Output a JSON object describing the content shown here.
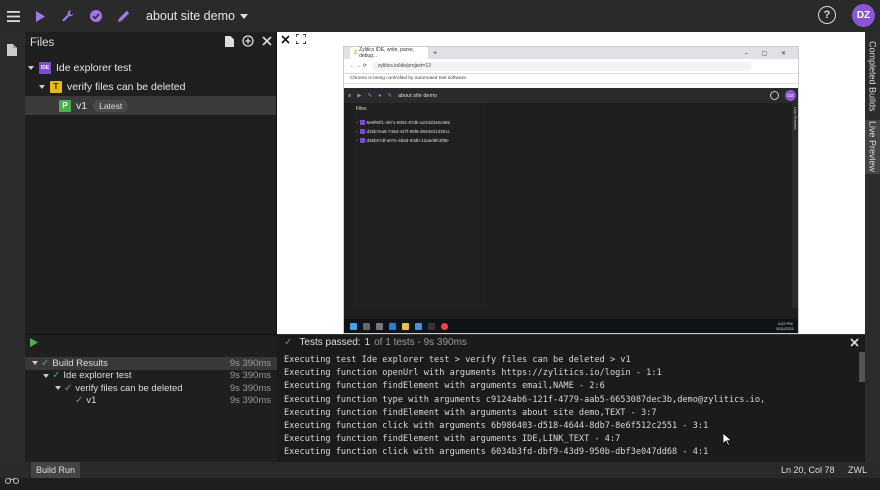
{
  "topbar": {
    "project_name": "about site demo",
    "avatar_initials": "DZ",
    "help_label": "?",
    "icons": [
      "menu-icon",
      "run-icon",
      "wrench-icon",
      "check-circle-icon",
      "pencil-icon"
    ],
    "accent_color": "#8a55d6"
  },
  "files_panel": {
    "title": "Files",
    "tree": [
      {
        "label": "Ide explorer test",
        "badge": "IDE"
      },
      {
        "label": "verify files can be deleted",
        "badge": "T"
      },
      {
        "label": "v1",
        "badge": "P",
        "tag": "Latest"
      }
    ]
  },
  "preview": {
    "browser_tab_title": "Zylitics IDE, write, parse, debug...",
    "browser_url": "zylitics.io/ide/project=13",
    "automation_notice": "Chrome is being controlled by automated test software.",
    "inner_project_name": "about site demo",
    "inner_avatar": "DZ",
    "inner_files_title": "Files",
    "inner_files": [
      "5e6f90f1-4971-8091-87db-a233d346c865",
      "d35b7ea8-749d-437f-85f8-d840e013301c",
      "d36b57df-a07e-4b8d-93db-12a5d9fc0f8e"
    ],
    "inner_live_preview": "Live Preview",
    "taskbar_time": "4:22 PM",
    "taskbar_date": "5/31/2021"
  },
  "right_rail": {
    "completed_builds": "Completed Builds",
    "live_preview": "Live Preview"
  },
  "results": {
    "rows": [
      {
        "label": "Build Results",
        "time": "9s 390ms"
      },
      {
        "label": "Ide explorer test",
        "time": "9s 390ms"
      },
      {
        "label": "verify files can be deleted",
        "time": "9s 390ms"
      },
      {
        "label": "v1",
        "time": "9s 390ms"
      }
    ]
  },
  "console": {
    "summary_prefix": "Tests passed:",
    "summary_count": "1",
    "summary_rest": "of 1 tests - 9s 390ms",
    "lines": [
      "Executing test Ide explorer test > verify files can be deleted > v1",
      "Executing function openUrl with arguments https://zylitics.io/login - 1:1",
      "Executing function findElement with arguments email,NAME - 2:6",
      "Executing function type with arguments c9124ab6-121f-4779-aab5-6653087dec3b,demo@zylitics.io,",
      "Executing function findElement with arguments about site demo,TEXT - 3:7",
      "Executing function click with arguments 6b986403-d518-4644-8db7-8e6f512c2551 - 3:1",
      "Executing function findElement with arguments IDE,LINK_TEXT - 4:7",
      "Executing function click with arguments 6034b3fd-dbf9-43d9-950b-dbf3e047dd68 - 4:1"
    ]
  },
  "status": {
    "build_run": "Build Run",
    "cursor_pos": "Ln 20, Col 78",
    "language": "ZWL"
  }
}
